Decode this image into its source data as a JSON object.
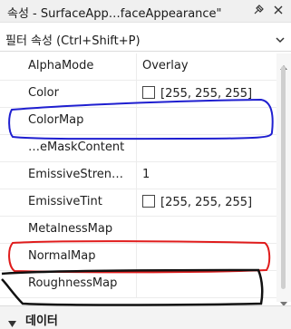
{
  "window": {
    "title": "속성 - SurfaceApp…faceAppearance\"",
    "pin_icon": "pin-icon",
    "close_icon": "close-icon"
  },
  "filter": {
    "placeholder": "필터 속성 (Ctrl+Shift+P)",
    "dropdown_icon": "chevron-down-icon"
  },
  "properties": [
    {
      "name": "AlphaMode",
      "value": "Overlay"
    },
    {
      "name": "Color",
      "value": "[255, 255, 255]",
      "swatch": "#ffffff"
    },
    {
      "name": "ColorMap",
      "value": ""
    },
    {
      "name": "…eMaskContent",
      "value": ""
    },
    {
      "name": "EmissiveStren…",
      "value": "1"
    },
    {
      "name": "EmissiveTint",
      "value": "[255, 255, 255]",
      "swatch": "#ffffff"
    },
    {
      "name": "MetalnessMap",
      "value": ""
    },
    {
      "name": "NormalMap",
      "value": ""
    },
    {
      "name": "RoughnessMap",
      "value": ""
    }
  ],
  "category": {
    "label": "데이터",
    "icon": "triangle-down-icon"
  },
  "annotation_colors": {
    "blue": "#1f1fd0",
    "red": "#e01c1c",
    "black": "#111111"
  }
}
